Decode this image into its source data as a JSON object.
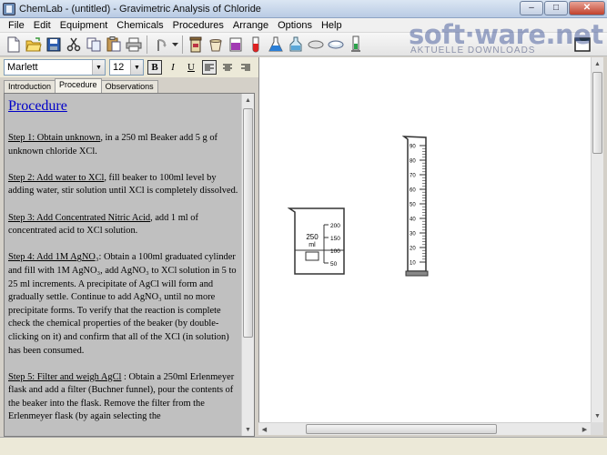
{
  "window": {
    "title": "ChemLab - (untitled) - Gravimetric Analysis of Chloride",
    "minimize": "–",
    "maximize": "□",
    "close": "✕"
  },
  "menu": [
    "File",
    "Edit",
    "Equipment",
    "Chemicals",
    "Procedures",
    "Arrange",
    "Options",
    "Help"
  ],
  "toolbar": {
    "icons": [
      "new-file",
      "open-folder",
      "save",
      "cut",
      "copy",
      "paste",
      "print",
      "undo",
      "equipment-container",
      "crucible",
      "beaker-purple",
      "test-tube",
      "flask-blue",
      "wash-bottle",
      "dish",
      "evaporating-dish",
      "cylinder"
    ]
  },
  "format": {
    "font_name": "Marlett",
    "font_size": "12",
    "bold": "B",
    "italic": "I",
    "underline": "U"
  },
  "tabs": {
    "introduction": "Introduction",
    "procedure": "Procedure",
    "observations": "Observations"
  },
  "procedure": {
    "heading": "Procedure",
    "step1_title": "Step 1: Obtain unknown",
    "step1_body": ", in a 250 ml Beaker add 5 g of unknown chloride XCl.",
    "step2_title": "Step 2: Add water to XCl",
    "step2_body": ",  fill beaker to 100ml level by adding water, stir solution until XCl is completely dissolved.",
    "step3_title": "Step 3: Add Concentrated Nitric Acid",
    "step3_body": ", add 1 ml of concentrated acid to XCl solution.",
    "step4_title": "Step 4: Add 1M AgNO₃",
    "step4_body": ":  Obtain a 100ml graduated cylinder and fill with 1M AgNO₃, add AgNO₃ to XCl solution in 5 to 25 ml increments. A precipitate of AgCl will form and gradually settle. Continue to add AgNO₃ until no more precipitate forms. To verify that the reaction is complete check the chemical properties of the beaker (by double-clicking on it) and confirm that all of the XCl (in solution) has been consumed.",
    "step5_title": "Step 5:  Filter and weigh AgCl",
    "step5_body": " : Obtain  a 250ml Erlenmeyer flask and add a filter (Buchner funnel), pour the contents of the beaker into the flask. Remove the filter from the Erlenmeyer flask  (by again selecting the"
  },
  "beaker": {
    "size_label": "250",
    "unit_label": "ml",
    "marks": [
      "200",
      "150",
      "100",
      "50"
    ],
    "fill_level_ml": 100,
    "capacity_ml": 250
  },
  "cylinder": {
    "marks": [
      "90",
      "80",
      "70",
      "60",
      "50",
      "40",
      "30",
      "20",
      "10"
    ]
  },
  "watermark": {
    "brand": "soft·ware.net",
    "tagline": "AKTUELLE DOWNLOADS"
  }
}
